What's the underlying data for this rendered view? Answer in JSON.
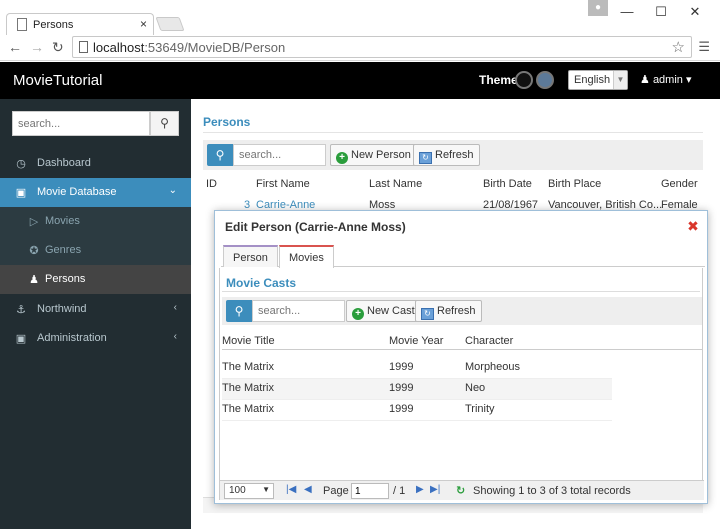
{
  "browser": {
    "tab_title": "Persons",
    "url_host": "localhost",
    "url_rest": ":53649/MovieDB/Person",
    "min_glyph": "—",
    "max_glyph": "☐",
    "close_glyph": "✕",
    "tab_close_glyph": "×"
  },
  "header": {
    "brand": "MovieTutorial",
    "theme_label": "Theme",
    "language": "English",
    "user": "admin"
  },
  "sidebar": {
    "search_placeholder": "search...",
    "items": [
      {
        "label": "Dashboard"
      },
      {
        "label": "Movie Database"
      },
      {
        "label": "Movies"
      },
      {
        "label": "Genres"
      },
      {
        "label": "Persons"
      },
      {
        "label": "Northwind"
      },
      {
        "label": "Administration"
      }
    ]
  },
  "persons": {
    "title": "Persons",
    "search_placeholder": "search...",
    "new_button": "New Person",
    "refresh_button": "Refresh",
    "columns": [
      "ID",
      "First Name",
      "Last Name",
      "Birth Date",
      "Birth Place",
      "Gender"
    ],
    "row": {
      "id": "3",
      "first": "Carrie-Anne",
      "last": "Moss",
      "birth_date": "21/08/1967",
      "birth_place": "Vancouver, British Co...",
      "gender": "Female"
    }
  },
  "dialog": {
    "title": "Edit Person (Carrie-Anne Moss)",
    "tabs": [
      "Person",
      "Movies"
    ],
    "casts_title": "Movie Casts",
    "search_placeholder": "search...",
    "new_button": "New Cast",
    "refresh_button": "Refresh",
    "columns": [
      "Movie Title",
      "Movie Year",
      "Character"
    ],
    "rows": [
      {
        "title": "The Matrix",
        "year": "1999",
        "character": "Morpheous"
      },
      {
        "title": "The Matrix",
        "year": "1999",
        "character": "Neo"
      },
      {
        "title": "The Matrix",
        "year": "1999",
        "character": "Trinity"
      }
    ],
    "pager": {
      "page_size": "100",
      "page_label": "Page",
      "page_value": "1",
      "page_of": "/ 1",
      "status": "Showing 1 to 3 of 3 total records"
    }
  },
  "colors": {
    "accent": "#3c8dbc",
    "sidebar": "#222d32",
    "header": "#000000",
    "close": "#d9362b"
  }
}
